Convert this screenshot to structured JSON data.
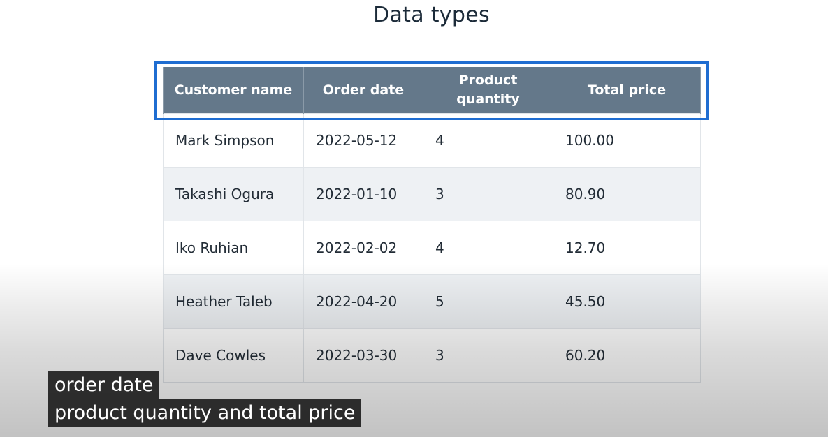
{
  "slide": {
    "title": "Data types"
  },
  "table": {
    "columns": [
      "Customer name",
      "Order date",
      "Product quantity",
      "Total price"
    ],
    "rows": [
      [
        "Mark Simpson",
        "2022-05-12",
        "4",
        "100.00"
      ],
      [
        "Takashi Ogura",
        "2022-01-10",
        "3",
        "80.90"
      ],
      [
        "Iko Ruhian",
        "2022-02-02",
        "4",
        "12.70"
      ],
      [
        "Heather Taleb",
        "2022-04-20",
        "5",
        "45.50"
      ],
      [
        "Dave Cowles",
        "2022-03-30",
        "3",
        "60.20"
      ]
    ]
  },
  "captions": {
    "line1": "order date",
    "line2": "product quantity and total price"
  },
  "colors": {
    "header_bg": "#64788a",
    "highlight_border": "#1f6dd1",
    "alt_row": "#eef1f4"
  }
}
